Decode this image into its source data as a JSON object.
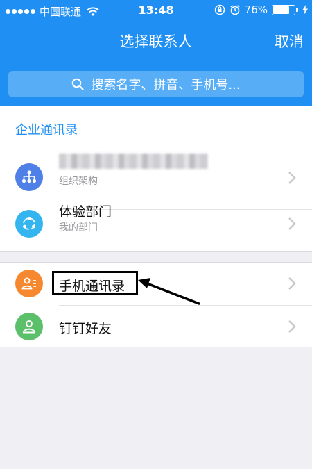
{
  "status_bar": {
    "carrier": "中国联通",
    "time": "13:48",
    "battery": "76%",
    "battery_level": 0.76
  },
  "nav": {
    "title": "选择联系人",
    "cancel_label": "取消"
  },
  "search": {
    "placeholder": "搜索名字、拼音、手机号..."
  },
  "enterprise": {
    "section_label": "企业通讯录",
    "items": [
      {
        "title": "",
        "subtitle": "组织架构",
        "icon": "org-chart-icon",
        "color": "#4f80e8"
      },
      {
        "title": "体验部门",
        "subtitle": "我的部门",
        "icon": "share-circle-icon",
        "color": "#35b5f0"
      }
    ]
  },
  "other": {
    "items": [
      {
        "title": "手机通讯录",
        "icon": "contact-card-icon",
        "color": "#f6892f"
      },
      {
        "title": "钉钉好友",
        "icon": "person-icon",
        "color": "#5cbf6a"
      }
    ]
  }
}
